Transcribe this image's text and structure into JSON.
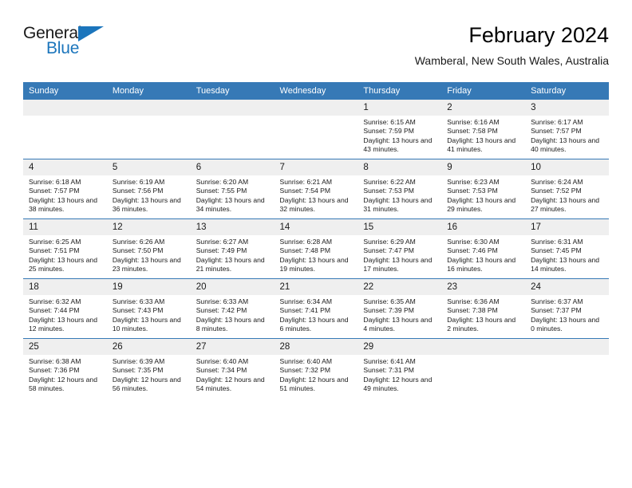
{
  "brand": {
    "name_part1": "General",
    "name_part2": "Blue",
    "flag_icon": "blue-flag-triangle-icon",
    "accent_color": "#1b75bc"
  },
  "header": {
    "title": "February 2024",
    "subtitle": "Wamberal, New South Wales, Australia"
  },
  "theme": {
    "header_row_bg": "#3679b6",
    "header_row_text": "#ffffff",
    "daynum_bg": "#efefef",
    "row_divider": "#3679b6",
    "page_bg": "#ffffff"
  },
  "weekday_headers": [
    "Sunday",
    "Monday",
    "Tuesday",
    "Wednesday",
    "Thursday",
    "Friday",
    "Saturday"
  ],
  "labels": {
    "sunrise_prefix": "Sunrise:",
    "sunset_prefix": "Sunset:",
    "daylight_prefix": "Daylight:"
  },
  "weeks": [
    [
      {
        "day": "",
        "empty": true
      },
      {
        "day": "",
        "empty": true
      },
      {
        "day": "",
        "empty": true
      },
      {
        "day": "",
        "empty": true
      },
      {
        "day": "1",
        "sunrise": "Sunrise: 6:15 AM",
        "sunset": "Sunset: 7:59 PM",
        "daylight": "Daylight: 13 hours and 43 minutes."
      },
      {
        "day": "2",
        "sunrise": "Sunrise: 6:16 AM",
        "sunset": "Sunset: 7:58 PM",
        "daylight": "Daylight: 13 hours and 41 minutes."
      },
      {
        "day": "3",
        "sunrise": "Sunrise: 6:17 AM",
        "sunset": "Sunset: 7:57 PM",
        "daylight": "Daylight: 13 hours and 40 minutes."
      }
    ],
    [
      {
        "day": "4",
        "sunrise": "Sunrise: 6:18 AM",
        "sunset": "Sunset: 7:57 PM",
        "daylight": "Daylight: 13 hours and 38 minutes."
      },
      {
        "day": "5",
        "sunrise": "Sunrise: 6:19 AM",
        "sunset": "Sunset: 7:56 PM",
        "daylight": "Daylight: 13 hours and 36 minutes."
      },
      {
        "day": "6",
        "sunrise": "Sunrise: 6:20 AM",
        "sunset": "Sunset: 7:55 PM",
        "daylight": "Daylight: 13 hours and 34 minutes."
      },
      {
        "day": "7",
        "sunrise": "Sunrise: 6:21 AM",
        "sunset": "Sunset: 7:54 PM",
        "daylight": "Daylight: 13 hours and 32 minutes."
      },
      {
        "day": "8",
        "sunrise": "Sunrise: 6:22 AM",
        "sunset": "Sunset: 7:53 PM",
        "daylight": "Daylight: 13 hours and 31 minutes."
      },
      {
        "day": "9",
        "sunrise": "Sunrise: 6:23 AM",
        "sunset": "Sunset: 7:53 PM",
        "daylight": "Daylight: 13 hours and 29 minutes."
      },
      {
        "day": "10",
        "sunrise": "Sunrise: 6:24 AM",
        "sunset": "Sunset: 7:52 PM",
        "daylight": "Daylight: 13 hours and 27 minutes."
      }
    ],
    [
      {
        "day": "11",
        "sunrise": "Sunrise: 6:25 AM",
        "sunset": "Sunset: 7:51 PM",
        "daylight": "Daylight: 13 hours and 25 minutes."
      },
      {
        "day": "12",
        "sunrise": "Sunrise: 6:26 AM",
        "sunset": "Sunset: 7:50 PM",
        "daylight": "Daylight: 13 hours and 23 minutes."
      },
      {
        "day": "13",
        "sunrise": "Sunrise: 6:27 AM",
        "sunset": "Sunset: 7:49 PM",
        "daylight": "Daylight: 13 hours and 21 minutes."
      },
      {
        "day": "14",
        "sunrise": "Sunrise: 6:28 AM",
        "sunset": "Sunset: 7:48 PM",
        "daylight": "Daylight: 13 hours and 19 minutes."
      },
      {
        "day": "15",
        "sunrise": "Sunrise: 6:29 AM",
        "sunset": "Sunset: 7:47 PM",
        "daylight": "Daylight: 13 hours and 17 minutes."
      },
      {
        "day": "16",
        "sunrise": "Sunrise: 6:30 AM",
        "sunset": "Sunset: 7:46 PM",
        "daylight": "Daylight: 13 hours and 16 minutes."
      },
      {
        "day": "17",
        "sunrise": "Sunrise: 6:31 AM",
        "sunset": "Sunset: 7:45 PM",
        "daylight": "Daylight: 13 hours and 14 minutes."
      }
    ],
    [
      {
        "day": "18",
        "sunrise": "Sunrise: 6:32 AM",
        "sunset": "Sunset: 7:44 PM",
        "daylight": "Daylight: 13 hours and 12 minutes."
      },
      {
        "day": "19",
        "sunrise": "Sunrise: 6:33 AM",
        "sunset": "Sunset: 7:43 PM",
        "daylight": "Daylight: 13 hours and 10 minutes."
      },
      {
        "day": "20",
        "sunrise": "Sunrise: 6:33 AM",
        "sunset": "Sunset: 7:42 PM",
        "daylight": "Daylight: 13 hours and 8 minutes."
      },
      {
        "day": "21",
        "sunrise": "Sunrise: 6:34 AM",
        "sunset": "Sunset: 7:41 PM",
        "daylight": "Daylight: 13 hours and 6 minutes."
      },
      {
        "day": "22",
        "sunrise": "Sunrise: 6:35 AM",
        "sunset": "Sunset: 7:39 PM",
        "daylight": "Daylight: 13 hours and 4 minutes."
      },
      {
        "day": "23",
        "sunrise": "Sunrise: 6:36 AM",
        "sunset": "Sunset: 7:38 PM",
        "daylight": "Daylight: 13 hours and 2 minutes."
      },
      {
        "day": "24",
        "sunrise": "Sunrise: 6:37 AM",
        "sunset": "Sunset: 7:37 PM",
        "daylight": "Daylight: 13 hours and 0 minutes."
      }
    ],
    [
      {
        "day": "25",
        "sunrise": "Sunrise: 6:38 AM",
        "sunset": "Sunset: 7:36 PM",
        "daylight": "Daylight: 12 hours and 58 minutes."
      },
      {
        "day": "26",
        "sunrise": "Sunrise: 6:39 AM",
        "sunset": "Sunset: 7:35 PM",
        "daylight": "Daylight: 12 hours and 56 minutes."
      },
      {
        "day": "27",
        "sunrise": "Sunrise: 6:40 AM",
        "sunset": "Sunset: 7:34 PM",
        "daylight": "Daylight: 12 hours and 54 minutes."
      },
      {
        "day": "28",
        "sunrise": "Sunrise: 6:40 AM",
        "sunset": "Sunset: 7:32 PM",
        "daylight": "Daylight: 12 hours and 51 minutes."
      },
      {
        "day": "29",
        "sunrise": "Sunrise: 6:41 AM",
        "sunset": "Sunset: 7:31 PM",
        "daylight": "Daylight: 12 hours and 49 minutes."
      },
      {
        "day": "",
        "empty": true
      },
      {
        "day": "",
        "empty": true
      }
    ]
  ]
}
